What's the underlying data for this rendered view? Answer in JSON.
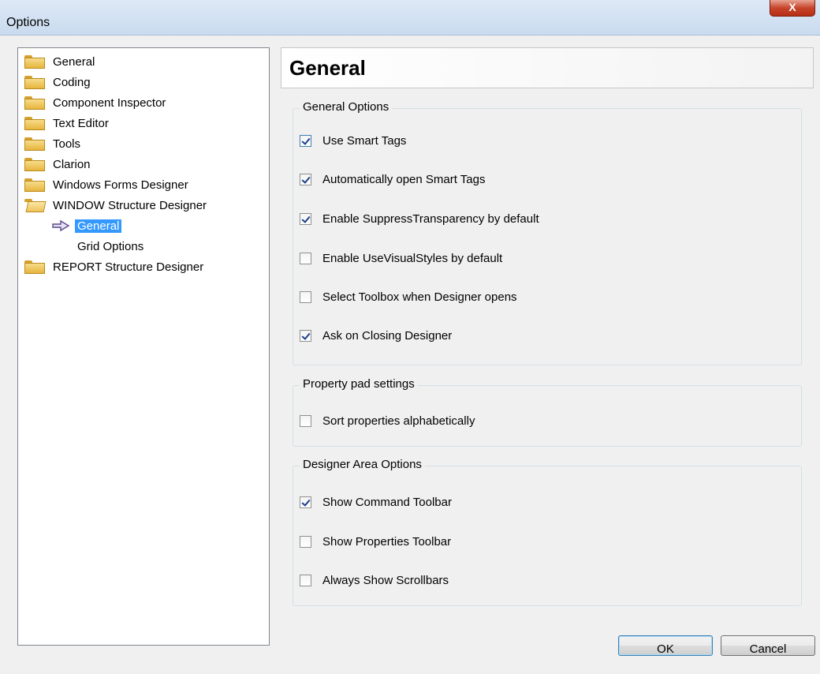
{
  "window": {
    "title": "Options",
    "close_label": "X"
  },
  "tree": {
    "items": [
      {
        "label": "General",
        "icon": "folder-icon"
      },
      {
        "label": "Coding",
        "icon": "folder-icon"
      },
      {
        "label": "Component Inspector",
        "icon": "folder-icon"
      },
      {
        "label": "Text Editor",
        "icon": "folder-icon"
      },
      {
        "label": "Tools",
        "icon": "folder-icon"
      },
      {
        "label": "Clarion",
        "icon": "folder-icon"
      },
      {
        "label": "Windows Forms Designer",
        "icon": "folder-icon"
      },
      {
        "label": "WINDOW Structure Designer",
        "icon": "folder-open-icon"
      },
      {
        "label": "General",
        "icon": "arrow-right-icon",
        "selected": true
      },
      {
        "label": "Grid Options"
      },
      {
        "label": "REPORT Structure Designer",
        "icon": "folder-icon"
      }
    ]
  },
  "panel": {
    "title": "General",
    "groups": [
      {
        "legend": "General Options",
        "options": [
          {
            "label": "Use Smart Tags",
            "checked": true
          },
          {
            "label": "Automatically open Smart Tags",
            "checked": true
          },
          {
            "label": "Enable SuppressTransparency by default",
            "checked": true
          },
          {
            "label": "Enable UseVisualStyles by default",
            "checked": false
          },
          {
            "label": "Select Toolbox when Designer opens",
            "checked": false
          },
          {
            "label": "Ask on Closing Designer",
            "checked": true
          }
        ]
      },
      {
        "legend": "Property pad settings",
        "options": [
          {
            "label": "Sort properties alphabetically",
            "checked": false
          }
        ]
      },
      {
        "legend": "Designer Area Options",
        "options": [
          {
            "label": "Show Command Toolbar",
            "checked": true
          },
          {
            "label": "Show Properties Toolbar",
            "checked": false
          },
          {
            "label": "Always Show Scrollbars",
            "checked": false
          }
        ]
      }
    ]
  },
  "buttons": {
    "ok": "OK",
    "cancel": "Cancel"
  },
  "colors": {
    "selection": "#3399ff",
    "group_border": "#d5dfe5",
    "check_mark": "#1c3e8c"
  }
}
